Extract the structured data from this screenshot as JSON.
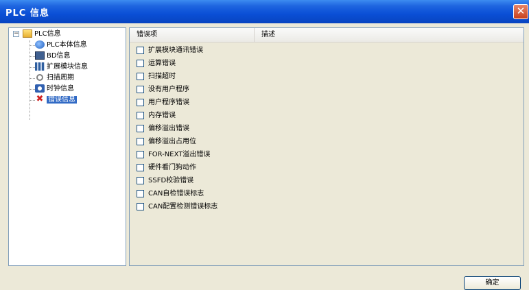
{
  "window": {
    "title": "PLC 信息"
  },
  "tree": {
    "root": "PLC信息",
    "items": [
      {
        "label": "PLC本体信息",
        "icon": "plc-body-icon"
      },
      {
        "label": "BD信息",
        "icon": "bd-board-icon"
      },
      {
        "label": "扩展模块信息",
        "icon": "extension-module-icon"
      },
      {
        "label": "扫描周期",
        "icon": "scan-cycle-icon"
      },
      {
        "label": "时钟信息",
        "icon": "clock-icon"
      },
      {
        "label": "错误信息",
        "icon": "error-icon",
        "selected": true
      }
    ]
  },
  "list": {
    "columns": [
      "错误项",
      "描述"
    ],
    "rows": [
      "扩展模块通讯错误",
      "运算错误",
      "扫描超时",
      "没有用户程序",
      "用户程序错误",
      "内存错误",
      "偏移溢出错误",
      "偏移溢出占用位",
      "FOR-NEXT溢出错误",
      "硬件看门狗动作",
      "SSFD校验错误",
      "CAN自检错误标志",
      "CAN配置检测错误标志"
    ]
  },
  "buttons": {
    "ok": "确定",
    "close": "✕"
  }
}
